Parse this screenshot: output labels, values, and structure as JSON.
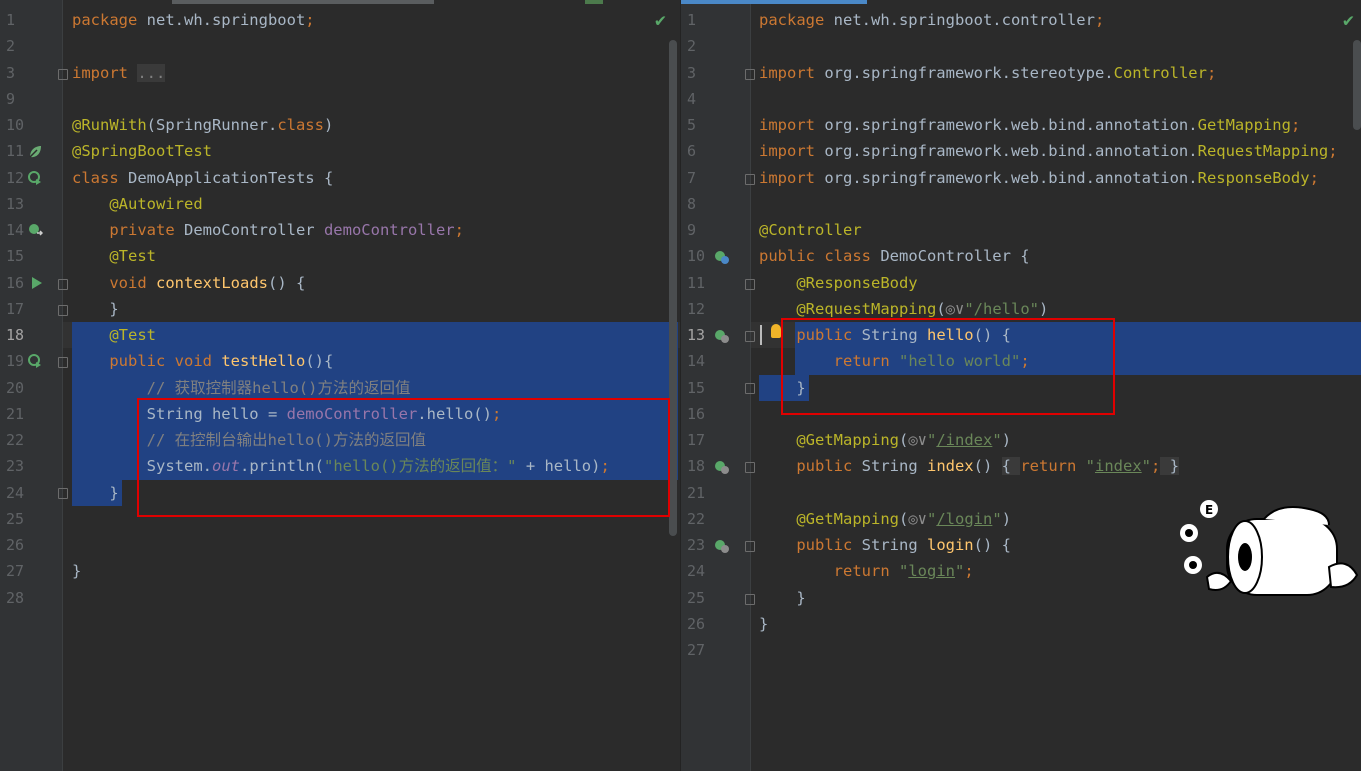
{
  "left_editor": {
    "lines": [
      {
        "n": "1",
        "html": "<span class='kw'>package </span>net.wh.springboot<span class='kw'>;</span>"
      },
      {
        "n": "2",
        "html": ""
      },
      {
        "n": "3",
        "html": "<span class='kw'>import </span><span style='background:#3a3a3a;color:#808080'>...</span>"
      },
      {
        "n": "9",
        "html": ""
      },
      {
        "n": "10",
        "html": "<span class='an'>@RunWith</span>(SpringRunner.<span class='kw'>class</span>)"
      },
      {
        "n": "11",
        "html": "<span class='an'>@SpringBootTest</span>"
      },
      {
        "n": "12",
        "html": "<span class='kw'>class </span>DemoApplicationTests {"
      },
      {
        "n": "13",
        "html": "    <span class='an'>@Autowired</span>"
      },
      {
        "n": "14",
        "html": "    <span class='kw'>private </span>DemoController <span class='fld'>demoController</span><span class='kw'>;</span>"
      },
      {
        "n": "15",
        "html": "    <span class='an'>@Test</span>"
      },
      {
        "n": "16",
        "html": "    <span class='kw'>void </span><span class='fn'>contextLoads</span>() {"
      },
      {
        "n": "17",
        "html": "    }"
      },
      {
        "n": "18",
        "html": "    <span class='an'>@Test</span>"
      },
      {
        "n": "19",
        "html": "    <span class='kw'>public void </span><span class='fn'>testHello</span>(){"
      },
      {
        "n": "20",
        "html": "        <span class='cm'>// 获取控制器hello()方法的返回值</span>"
      },
      {
        "n": "21",
        "html": "        String hello = <span class='fld'>demoController</span>.hello()<span class='kw'>;</span>"
      },
      {
        "n": "22",
        "html": "        <span class='cm'>// 在控制台输出hello()方法的返回值</span>"
      },
      {
        "n": "23",
        "html": "        System.<span class='fldi'>out</span>.println(<span class='str'>\"hello()方法的返回值：\"</span> + hello)<span class='kw'>;</span>"
      },
      {
        "n": "24",
        "html": "    }"
      },
      {
        "n": "25",
        "html": ""
      },
      {
        "n": "26",
        "html": ""
      },
      {
        "n": "27",
        "html": "}"
      },
      {
        "n": "28",
        "html": ""
      }
    ]
  },
  "right_editor": {
    "lines": [
      {
        "n": "1",
        "html": "<span class='kw'>package </span>net.wh.springboot.controller<span class='kw'>;</span>"
      },
      {
        "n": "2",
        "html": ""
      },
      {
        "n": "3",
        "html": "<span class='kw'>import </span>org.springframework.stereotype.<span class='an'>Controller</span><span class='kw'>;</span>"
      },
      {
        "n": "4",
        "html": ""
      },
      {
        "n": "5",
        "html": "<span class='kw'>import </span>org.springframework.web.bind.annotation.<span class='an'>GetMapping</span><span class='kw'>;</span>"
      },
      {
        "n": "6",
        "html": "<span class='kw'>import </span>org.springframework.web.bind.annotation.<span class='an'>RequestMapping</span><span class='kw'>;</span>"
      },
      {
        "n": "7",
        "html": "<span class='kw'>import </span>org.springframework.web.bind.annotation.<span class='an'>ResponseBody</span><span class='kw'>;</span>"
      },
      {
        "n": "8",
        "html": ""
      },
      {
        "n": "9",
        "html": "<span class='an'>@Controller</span>"
      },
      {
        "n": "10",
        "html": "<span class='kw'>public class </span>DemoController {"
      },
      {
        "n": "11",
        "html": "    <span class='an'>@ResponseBody</span>"
      },
      {
        "n": "12",
        "html": "    <span class='an'>@RequestMapping</span>(<span style='color:#8c8c8c'>◎∨</span><span class='str'>\"/hello\"</span>)"
      },
      {
        "n": "13",
        "html": "    <span class='kw'>public </span>String <span class='fn'>hello</span>() {"
      },
      {
        "n": "14",
        "html": "        <span class='kw'>return </span><span class='str'>\"hello world\"</span><span class='kw'>;</span>"
      },
      {
        "n": "15",
        "html": "    }"
      },
      {
        "n": "16",
        "html": ""
      },
      {
        "n": "17",
        "html": "    <span class='an'>@GetMapping</span>(<span style='color:#8c8c8c'>◎∨</span><span class='str'>\"<span class='ul'>/index</span>\"</span>)"
      },
      {
        "n": "18",
        "html": "    <span class='kw'>public </span>String <span class='fn'>index</span>() <span style='background:#3a3a3a'>{ </span><span class='kw'>return </span><span class='str'>\"<span class='ul'>index</span>\"</span><span class='kw'>;</span><span style='background:#3a3a3a'> }</span>"
      },
      {
        "n": "21",
        "html": ""
      },
      {
        "n": "22",
        "html": "    <span class='an'>@GetMapping</span>(<span style='color:#8c8c8c'>◎∨</span><span class='str'>\"<span class='ul'>/login</span>\"</span>)"
      },
      {
        "n": "23",
        "html": "    <span class='kw'>public </span>String <span class='fn'>login</span>() {"
      },
      {
        "n": "24",
        "html": "        <span class='kw'>return </span><span class='str'>\"<span class='ul'>login</span>\"</span><span class='kw'>;</span>"
      },
      {
        "n": "25",
        "html": "    }"
      },
      {
        "n": "26",
        "html": "}"
      },
      {
        "n": "27",
        "html": ""
      }
    ]
  },
  "icons": {
    "left_status": "check-icon",
    "right_status": "check-icon",
    "mascot": "toilet-paper-mascot-icon"
  },
  "colors": {
    "selection": "#214283",
    "annotation_box": "#e00000",
    "background": "#2b2b2b"
  }
}
